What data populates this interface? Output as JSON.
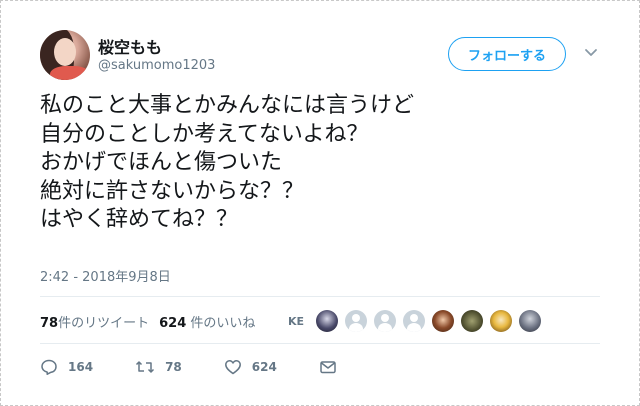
{
  "user": {
    "display_name": "桜空もも",
    "handle": "@sakumomo1203"
  },
  "follow_button": {
    "label": "フォローする"
  },
  "tweet": {
    "lines": [
      "私のこと大事とかみんなには言うけど",
      "自分のことしか考えてないよね？",
      "おかげでほんと傷ついた",
      "絶対に許さないからな？？",
      "はやく辞めてね？？"
    ],
    "timestamp": "2:42 - 2018年9月8日"
  },
  "stats": {
    "retweets_count": "78",
    "retweets_label": "件のリツイート",
    "likes_count": "624",
    "likes_label": "件のいいね"
  },
  "likers": {
    "label": "KE",
    "avatars": [
      "liker-avatar-1",
      "liker-avatar-2",
      "liker-avatar-3",
      "liker-avatar-4",
      "liker-avatar-5",
      "liker-avatar-6",
      "liker-avatar-7",
      "liker-avatar-8"
    ]
  },
  "actions": {
    "reply_count": "164",
    "retweet_count": "78",
    "like_count": "624"
  },
  "colors": {
    "accent": "#1da1f2",
    "text": "#14171a",
    "secondary": "#657786",
    "divider": "#e6ecf0"
  }
}
